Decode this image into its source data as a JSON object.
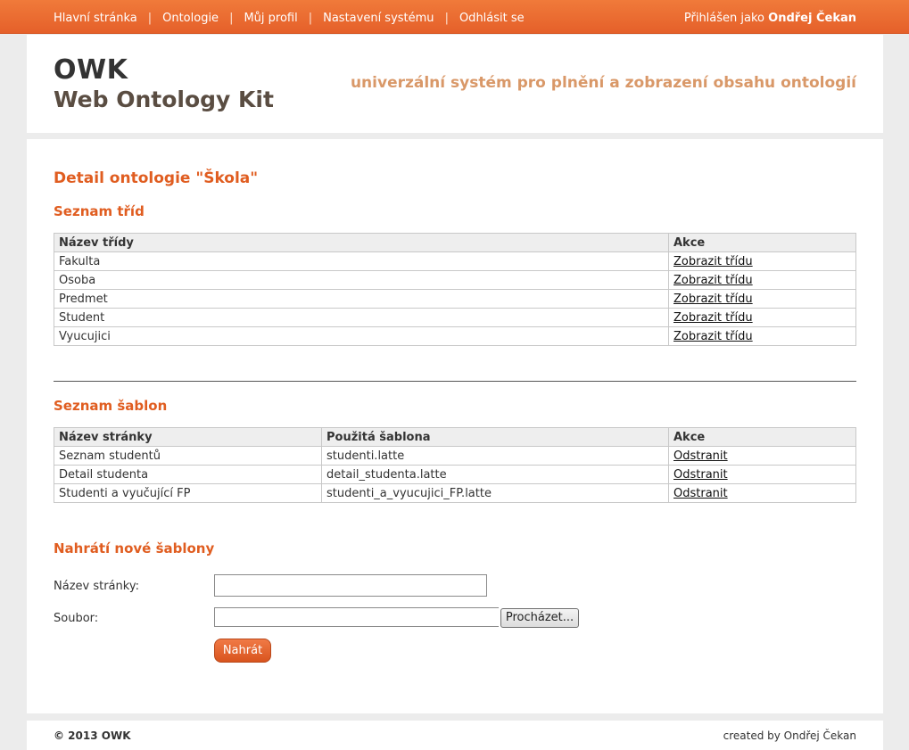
{
  "nav": {
    "items": [
      "Hlavní stránka",
      "Ontologie",
      "Můj profil",
      "Nastavení systému",
      "Odhlásit se"
    ],
    "separator": "|",
    "logged_in_prefix": "Přihlášen jako",
    "user_name": "Ondřej Čekan"
  },
  "header": {
    "logo_main": "OWK",
    "logo_sub": "Web Ontology Kit",
    "tagline": "univerzální systém pro plnění a zobrazení obsahu ontologií"
  },
  "page": {
    "title": "Detail ontologie \"Škola\""
  },
  "classes": {
    "heading": "Seznam tříd",
    "columns": [
      "Název třídy",
      "Akce"
    ],
    "rows": [
      {
        "name": "Fakulta",
        "action": "Zobrazit třídu"
      },
      {
        "name": "Osoba",
        "action": "Zobrazit třídu"
      },
      {
        "name": "Predmet",
        "action": "Zobrazit třídu"
      },
      {
        "name": "Student",
        "action": "Zobrazit třídu"
      },
      {
        "name": "Vyucujici",
        "action": "Zobrazit třídu"
      }
    ]
  },
  "templates": {
    "heading": "Seznam šablon",
    "columns": [
      "Název stránky",
      "Použitá šablona",
      "Akce"
    ],
    "rows": [
      {
        "name": "Seznam studentů",
        "template": "studenti.latte",
        "action": "Odstranit"
      },
      {
        "name": "Detail studenta",
        "template": "detail_studenta.latte",
        "action": "Odstranit"
      },
      {
        "name": "Studenti a vyučující FP",
        "template": "studenti_a_vyucujici_FP.latte",
        "action": "Odstranit"
      }
    ]
  },
  "upload": {
    "heading": "Nahrátí nové šablony",
    "page_name_label": "Název stránky:",
    "page_name_value": "",
    "file_label": "Soubor:",
    "browse_label": "Procházet...",
    "submit_label": "Nahrát"
  },
  "footer": {
    "copyright": "© 2013 OWK",
    "credits": "created by Ondřej Čekan"
  },
  "colors": {
    "accent": "#e05d20",
    "topbar": "#ec6d33",
    "tagline": "#d99868"
  }
}
